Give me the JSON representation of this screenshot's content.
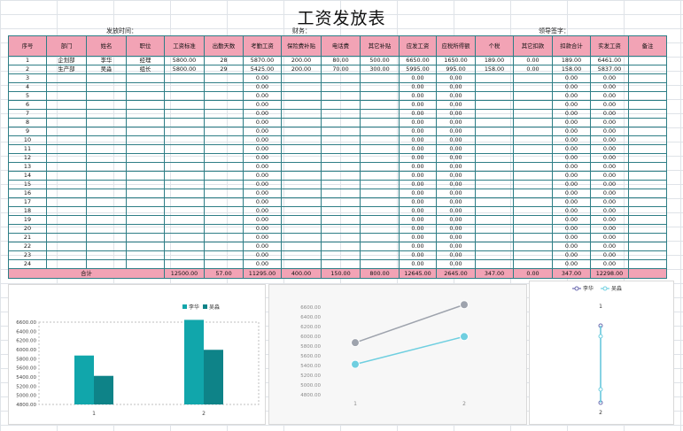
{
  "sheet": {
    "title": "工资发放表",
    "meta": {
      "pay_date_label": "发放时间：",
      "finance_label": "财务：",
      "leader_label": "领导签字："
    },
    "headers": [
      "序号",
      "部门",
      "姓名",
      "职位",
      "工资标准",
      "出勤天数",
      "考勤工资",
      "保险费补贴",
      "电话费",
      "其它补贴",
      "应发工资",
      "应税所得额",
      "个税",
      "其它扣款",
      "扣款合计",
      "实发工资",
      "备注"
    ],
    "rows": [
      [
        "1",
        "企划部",
        "李华",
        "经理",
        "5800.00",
        "28",
        "5870.00",
        "200.00",
        "80.00",
        "500.00",
        "6650.00",
        "1650.00",
        "189.00",
        "0.00",
        "189.00",
        "6461.00",
        ""
      ],
      [
        "2",
        "生产部",
        "吴淼",
        "组长",
        "5800.00",
        "29",
        "5425.00",
        "200.00",
        "70.00",
        "300.00",
        "5995.00",
        "995.00",
        "158.00",
        "0.00",
        "158.00",
        "5837.00",
        ""
      ],
      [
        "3",
        "",
        "",
        "",
        "",
        "",
        "0.00",
        "",
        "",
        "",
        "0.00",
        "0.00",
        "",
        "",
        "0.00",
        "0.00",
        ""
      ],
      [
        "4",
        "",
        "",
        "",
        "",
        "",
        "0.00",
        "",
        "",
        "",
        "0.00",
        "0.00",
        "",
        "",
        "0.00",
        "0.00",
        ""
      ],
      [
        "5",
        "",
        "",
        "",
        "",
        "",
        "0.00",
        "",
        "",
        "",
        "0.00",
        "0.00",
        "",
        "",
        "0.00",
        "0.00",
        ""
      ],
      [
        "6",
        "",
        "",
        "",
        "",
        "",
        "0.00",
        "",
        "",
        "",
        "0.00",
        "0.00",
        "",
        "",
        "0.00",
        "0.00",
        ""
      ],
      [
        "7",
        "",
        "",
        "",
        "",
        "",
        "0.00",
        "",
        "",
        "",
        "0.00",
        "0.00",
        "",
        "",
        "0.00",
        "0.00",
        ""
      ],
      [
        "8",
        "",
        "",
        "",
        "",
        "",
        "0.00",
        "",
        "",
        "",
        "0.00",
        "0.00",
        "",
        "",
        "0.00",
        "0.00",
        ""
      ],
      [
        "9",
        "",
        "",
        "",
        "",
        "",
        "0.00",
        "",
        "",
        "",
        "0.00",
        "0.00",
        "",
        "",
        "0.00",
        "0.00",
        ""
      ],
      [
        "10",
        "",
        "",
        "",
        "",
        "",
        "0.00",
        "",
        "",
        "",
        "0.00",
        "0.00",
        "",
        "",
        "0.00",
        "0.00",
        ""
      ],
      [
        "11",
        "",
        "",
        "",
        "",
        "",
        "0.00",
        "",
        "",
        "",
        "0.00",
        "0.00",
        "",
        "",
        "0.00",
        "0.00",
        ""
      ],
      [
        "12",
        "",
        "",
        "",
        "",
        "",
        "0.00",
        "",
        "",
        "",
        "0.00",
        "0.00",
        "",
        "",
        "0.00",
        "0.00",
        ""
      ],
      [
        "13",
        "",
        "",
        "",
        "",
        "",
        "0.00",
        "",
        "",
        "",
        "0.00",
        "0.00",
        "",
        "",
        "0.00",
        "0.00",
        ""
      ],
      [
        "14",
        "",
        "",
        "",
        "",
        "",
        "0.00",
        "",
        "",
        "",
        "0.00",
        "0.00",
        "",
        "",
        "0.00",
        "0.00",
        ""
      ],
      [
        "15",
        "",
        "",
        "",
        "",
        "",
        "0.00",
        "",
        "",
        "",
        "0.00",
        "0.00",
        "",
        "",
        "0.00",
        "0.00",
        ""
      ],
      [
        "16",
        "",
        "",
        "",
        "",
        "",
        "0.00",
        "",
        "",
        "",
        "0.00",
        "0.00",
        "",
        "",
        "0.00",
        "0.00",
        ""
      ],
      [
        "17",
        "",
        "",
        "",
        "",
        "",
        "0.00",
        "",
        "",
        "",
        "0.00",
        "0.00",
        "",
        "",
        "0.00",
        "0.00",
        ""
      ],
      [
        "18",
        "",
        "",
        "",
        "",
        "",
        "0.00",
        "",
        "",
        "",
        "0.00",
        "0.00",
        "",
        "",
        "0.00",
        "0.00",
        ""
      ],
      [
        "19",
        "",
        "",
        "",
        "",
        "",
        "0.00",
        "",
        "",
        "",
        "0.00",
        "0.00",
        "",
        "",
        "0.00",
        "0.00",
        ""
      ],
      [
        "20",
        "",
        "",
        "",
        "",
        "",
        "0.00",
        "",
        "",
        "",
        "0.00",
        "0.00",
        "",
        "",
        "0.00",
        "0.00",
        ""
      ],
      [
        "21",
        "",
        "",
        "",
        "",
        "",
        "0.00",
        "",
        "",
        "",
        "0.00",
        "0.00",
        "",
        "",
        "0.00",
        "0.00",
        ""
      ],
      [
        "22",
        "",
        "",
        "",
        "",
        "",
        "0.00",
        "",
        "",
        "",
        "0.00",
        "0.00",
        "",
        "",
        "0.00",
        "0.00",
        ""
      ],
      [
        "23",
        "",
        "",
        "",
        "",
        "",
        "0.00",
        "",
        "",
        "",
        "0.00",
        "0.00",
        "",
        "",
        "0.00",
        "0.00",
        ""
      ],
      [
        "24",
        "",
        "",
        "",
        "",
        "",
        "0.00",
        "",
        "",
        "",
        "0.00",
        "0.00",
        "",
        "",
        "0.00",
        "0.00",
        ""
      ]
    ],
    "total": {
      "label": "合计",
      "values": [
        "12500.00",
        "57.00",
        "11295.00",
        "400.00",
        "150.00",
        "800.00",
        "12645.00",
        "2645.00",
        "347.00",
        "0.00",
        "347.00",
        "12298.00",
        ""
      ]
    }
  },
  "colors": {
    "header_bg": "#f2a3b5",
    "border": "#2e7e86",
    "bar_a": "#11a6ab",
    "bar_b": "#0e8388",
    "line_a": "#9ea3ad",
    "line_b": "#6fcfe0",
    "vline": "#6c6bb0"
  },
  "chart_data": [
    {
      "type": "bar",
      "categories": [
        "1",
        "2"
      ],
      "series": [
        {
          "name": "李华",
          "values": [
            5870,
            6650
          ]
        },
        {
          "name": "吴淼",
          "values": [
            5425,
            5995
          ]
        }
      ],
      "yticks": [
        "4800.00",
        "5000.00",
        "5200.00",
        "5400.00",
        "5600.00",
        "5800.00",
        "6000.00",
        "6200.00",
        "6400.00",
        "6600.00"
      ],
      "ylim": [
        4800,
        6600
      ],
      "legend": "top"
    },
    {
      "type": "line",
      "categories": [
        "1",
        "2"
      ],
      "series": [
        {
          "values": [
            5870,
            6650
          ]
        },
        {
          "values": [
            5425,
            5995
          ]
        }
      ],
      "yticks": [
        "4800.00",
        "5000.00",
        "5200.00",
        "5400.00",
        "5600.00",
        "5800.00",
        "6000.00",
        "6200.00",
        "6400.00",
        "6600.00"
      ],
      "ylim": [
        4800,
        6600
      ]
    },
    {
      "type": "line",
      "orientation": "vertical",
      "categories": [
        "1",
        "2"
      ],
      "series": [
        {
          "name": "李华",
          "values": [
            5870,
            6650
          ]
        },
        {
          "name": "吴淼",
          "values": [
            5425,
            5995
          ]
        }
      ],
      "legend": "top"
    }
  ]
}
